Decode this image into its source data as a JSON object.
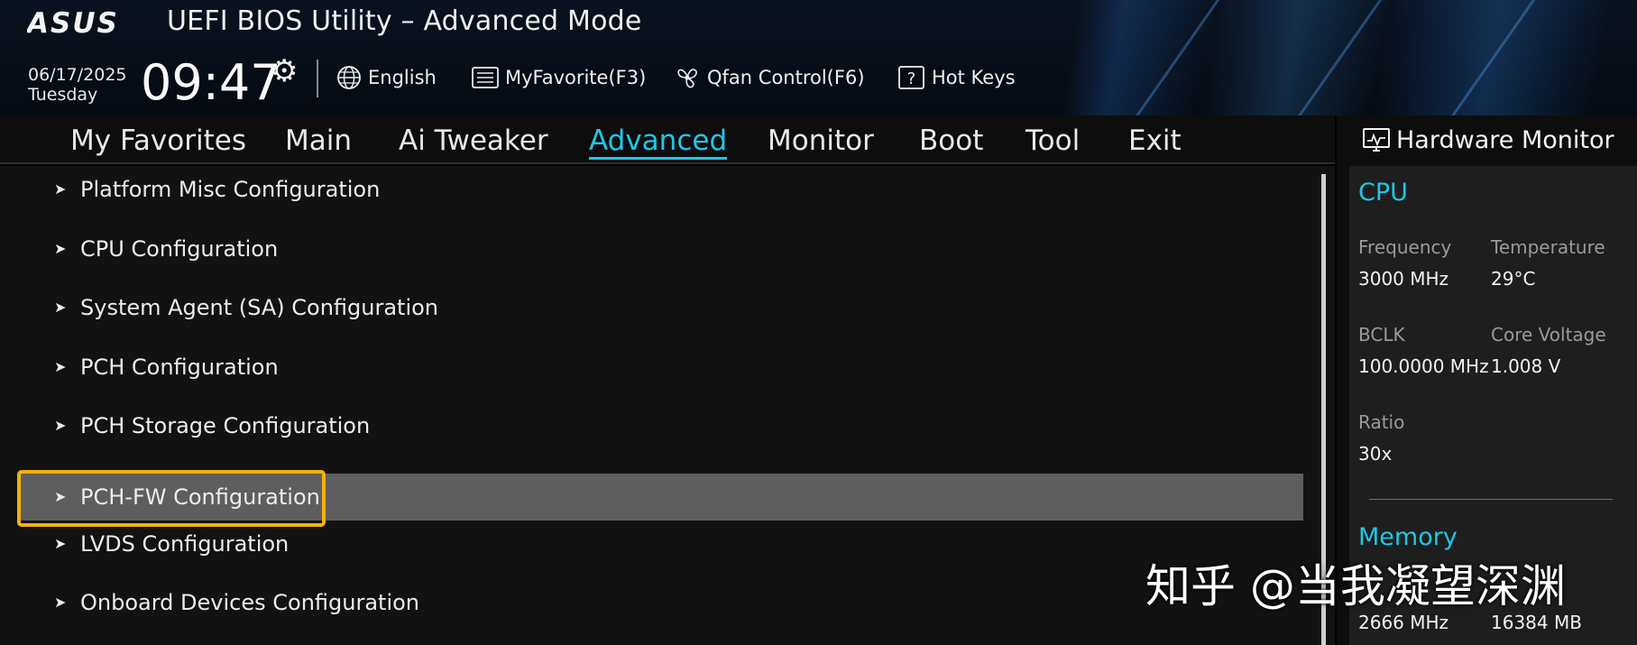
{
  "header": {
    "brand": "ASUS",
    "app_title": "UEFI BIOS Utility – Advanced Mode",
    "date": "06/17/2025",
    "day": "Tuesday",
    "time": "09:47",
    "tools": [
      {
        "label": "English",
        "icon": "globe-icon"
      },
      {
        "label": "MyFavorite(F3)",
        "icon": "favorite-list-icon"
      },
      {
        "label": "Qfan Control(F6)",
        "icon": "fan-icon"
      },
      {
        "label": "Hot Keys",
        "icon": "question-icon"
      }
    ]
  },
  "nav": {
    "tabs": [
      {
        "label": "My Favorites"
      },
      {
        "label": "Main"
      },
      {
        "label": "Ai Tweaker"
      },
      {
        "label": "Advanced"
      },
      {
        "label": "Monitor"
      },
      {
        "label": "Boot"
      },
      {
        "label": "Tool"
      },
      {
        "label": "Exit"
      }
    ],
    "active": "Advanced"
  },
  "menu": {
    "items": [
      {
        "label": "Platform Misc Configuration"
      },
      {
        "label": "CPU Configuration"
      },
      {
        "label": "System Agent (SA) Configuration"
      },
      {
        "label": "PCH Configuration"
      },
      {
        "label": "PCH Storage Configuration"
      },
      {
        "label": "PCH-FW Configuration"
      },
      {
        "label": "LVDS Configuration"
      },
      {
        "label": "Onboard Devices Configuration"
      }
    ],
    "selected": "PCH-FW Configuration"
  },
  "hardware_monitor": {
    "title": "Hardware Monitor",
    "cpu": {
      "heading": "CPU",
      "frequency_label": "Frequency",
      "frequency_value": "3000 MHz",
      "temperature_label": "Temperature",
      "temperature_value": "29°C",
      "bclk_label": "BCLK",
      "bclk_value": "100.0000 MHz",
      "core_voltage_label": "Core Voltage",
      "core_voltage_value": "1.008 V",
      "ratio_label": "Ratio",
      "ratio_value": "30x"
    },
    "memory": {
      "heading": "Memory",
      "frequency_value": "2666 MHz",
      "capacity_value": "16384 MB"
    }
  },
  "watermark": "知乎 @当我凝望深渊",
  "colors": {
    "accent": "#21c6e6",
    "selection_outline": "#f2b10c",
    "selected_row": "#5e5e5e"
  }
}
